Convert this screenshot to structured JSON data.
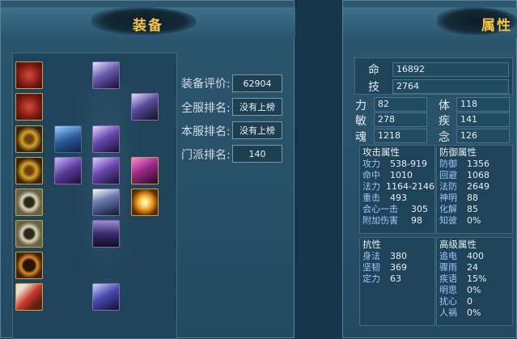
{
  "equipment_panel": {
    "title": "装备",
    "rating_label": "装备评价:",
    "rating_value": "62904",
    "server_rank_label": "全服排名:",
    "server_rank_value": "没有上榜",
    "local_rank_label": "本服排名:",
    "local_rank_value": "没有上榜",
    "faction_rank_label": "门派排名:",
    "faction_rank_value": "140"
  },
  "attributes_panel": {
    "title": "属性",
    "hp_label": "命",
    "hp_value": "16892",
    "skill_label": "技",
    "skill_value": "2764",
    "str_label": "力",
    "str_value": "82",
    "body_label": "体",
    "body_value": "118",
    "agi_label": "敏",
    "agi_value": "278",
    "spd_label": "疾",
    "spd_value": "141",
    "soul_label": "魂",
    "soul_value": "1218",
    "mind_label": "念",
    "mind_value": "126",
    "attack": {
      "header": "攻击属性",
      "rows": [
        {
          "n": "攻力",
          "v": "538-919"
        },
        {
          "n": "命中",
          "v": "1010"
        },
        {
          "n": "法力",
          "v": "1164-2146"
        },
        {
          "n": "重击",
          "v": "493"
        },
        {
          "n": "会心一击",
          "v": "305"
        },
        {
          "n": "附加伤害",
          "v": "98"
        }
      ]
    },
    "defense": {
      "header": "防御属性",
      "rows": [
        {
          "n": "防御",
          "v": "1356"
        },
        {
          "n": "回避",
          "v": "1068"
        },
        {
          "n": "法防",
          "v": "2649"
        },
        {
          "n": "神明",
          "v": "88"
        },
        {
          "n": "化解",
          "v": "85"
        },
        {
          "n": "知彼",
          "v": "0%"
        }
      ]
    },
    "resist": {
      "header": "抗性",
      "rows": [
        {
          "n": "身法",
          "v": "380"
        },
        {
          "n": "坚韧",
          "v": "369"
        },
        {
          "n": "定力",
          "v": "63"
        }
      ]
    },
    "advanced": {
      "header": "高级属性",
      "rows": [
        {
          "n": "追电",
          "v": "400"
        },
        {
          "n": "骤雨",
          "v": "24"
        },
        {
          "n": "疾语",
          "v": "15%"
        },
        {
          "n": "明思",
          "v": "0%"
        },
        {
          "n": "扰心",
          "v": "0"
        },
        {
          "n": "人祸",
          "v": "0%"
        }
      ]
    }
  },
  "colors": {
    "title": "#f3c64a",
    "frame_gold": "#c9a24e",
    "stat_blue": "#9fc6ff"
  }
}
